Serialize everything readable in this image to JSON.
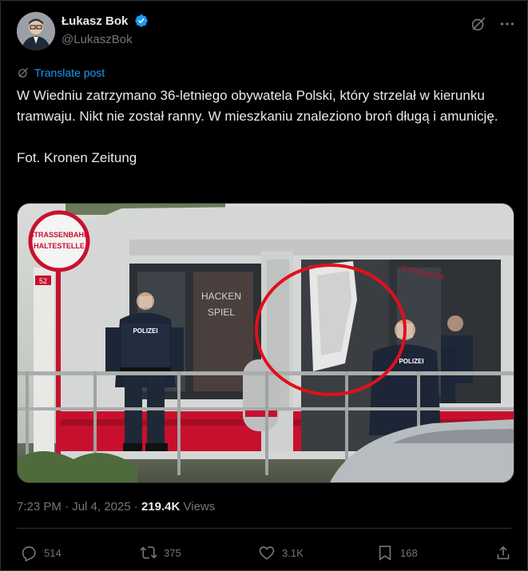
{
  "author": {
    "display_name": "Łukasz Bok",
    "handle": "@LukaszBok",
    "verified_icon": "verified-badge-icon"
  },
  "header_icons": [
    "grok-icon",
    "more-icon"
  ],
  "translate_label": "Translate post",
  "post": {
    "text": "W Wiedniu zatrzymano 36-letniego obywatela Polski, który strzelał w kierunku tramwaju. Nikt nie został ranny. W mieszkaniu znaleziono broń długą i amunicję.\n\nFot. Kronen Zeitung"
  },
  "photo": {
    "sign_line1": "STRASSENBAHN",
    "sign_line2": "HALTESTELLE",
    "tram_number": "52",
    "police_label": "POLIZEI",
    "colors": {
      "tram_red": "#c8102e",
      "highlight_circle": "#e0101a"
    }
  },
  "meta": {
    "time": "7:23 PM",
    "separator": "·",
    "date": "Jul 4, 2025",
    "views_count": "219.4K",
    "views_label": "Views"
  },
  "actions": {
    "replies": "514",
    "reposts": "375",
    "likes": "3.1K",
    "bookmarks": "168"
  },
  "colors": {
    "accent": "#1d9bf0",
    "muted": "#71767b",
    "text": "#e7e9ea",
    "border": "#2f3336"
  }
}
